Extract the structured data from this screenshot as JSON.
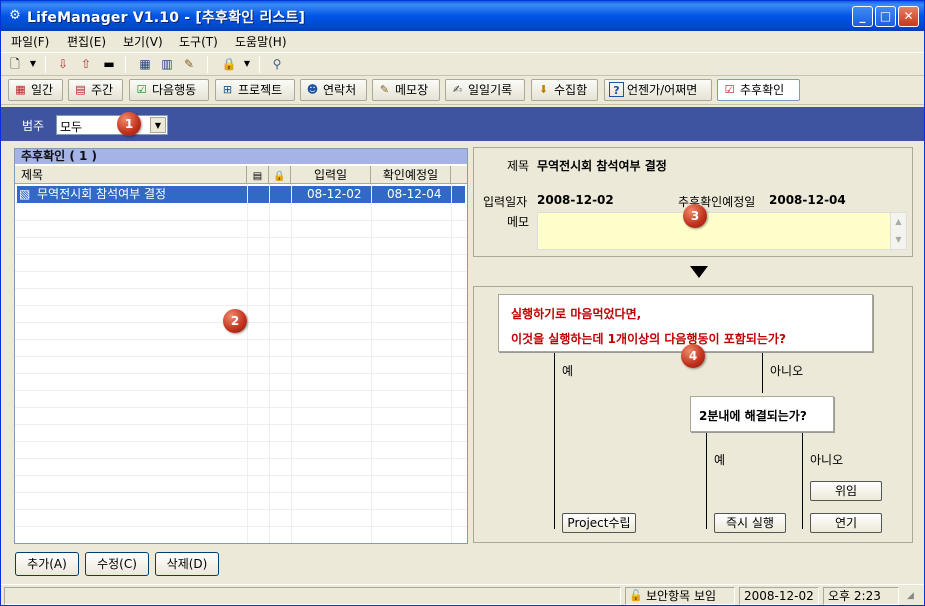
{
  "window": {
    "title": "LifeManager V1.10 - [추후확인 리스트]",
    "controls": [
      "minimize-icon",
      "maximize-icon",
      "close-icon"
    ]
  },
  "menu": [
    "파일(F)",
    "편집(E)",
    "보기(V)",
    "도구(T)",
    "도움말(H)"
  ],
  "nav_buttons": [
    {
      "label": "일간",
      "icon": "calendar-day-icon"
    },
    {
      "label": "주간",
      "icon": "calendar-week-icon"
    },
    {
      "label": "다음행동",
      "icon": "checklist-icon"
    },
    {
      "label": "프로젝트",
      "icon": "project-tree-icon"
    },
    {
      "label": "연락처",
      "icon": "contact-icon"
    },
    {
      "label": "메모장",
      "icon": "memo-icon"
    },
    {
      "label": "일일기록",
      "icon": "journal-icon"
    },
    {
      "label": "수집함",
      "icon": "inbox-icon"
    },
    {
      "label": "언젠가/어쩌면",
      "icon": "question-icon"
    },
    {
      "label": "추후확인",
      "icon": "followup-icon"
    }
  ],
  "filter": {
    "label": "범주",
    "value": "모두"
  },
  "badges": [
    "1",
    "2",
    "3",
    "4"
  ],
  "list": {
    "title": "추후확인 ( 1 )",
    "columns": [
      "제목",
      "",
      "",
      "입력일",
      "확인예정일"
    ],
    "rows": [
      {
        "title": "무역전시회 참석여부 결정",
        "input_date": "08-12-02",
        "due_date": "08-12-04"
      }
    ]
  },
  "buttons": {
    "add": "추가(A)",
    "edit": "수정(C)",
    "delete": "삭제(D)"
  },
  "detail": {
    "title_label": "제목",
    "title_value": "무역전시회 참석여부 결정",
    "input_label": "입력일자",
    "input_value": "2008-12-02",
    "due_label": "추후확인예정일",
    "due_value": "2008-12-04",
    "memo_label": "메모",
    "memo_value": ""
  },
  "flow": {
    "question1_line1": "실행하기로 마음먹었다면,",
    "question1_line2": "이것을 실행하는데 1개이상의 다음행동이 포함되는가?",
    "yes1": "예",
    "no1": "아니오",
    "question2": "2분내에 해결되는가?",
    "yes2": "예",
    "no2": "아니오",
    "btn_project": "Project수립",
    "btn_now": "즉시 실행",
    "btn_delegate": "위임",
    "btn_defer": "연기"
  },
  "status": {
    "security": "보안항목 보임",
    "date": "2008-12-02",
    "time": "오후 2:23"
  },
  "colors": {
    "accent": "#3f54a0",
    "question_text": "#c00000",
    "memo_bg": "#ffffcc",
    "selection": "#316ac5"
  }
}
